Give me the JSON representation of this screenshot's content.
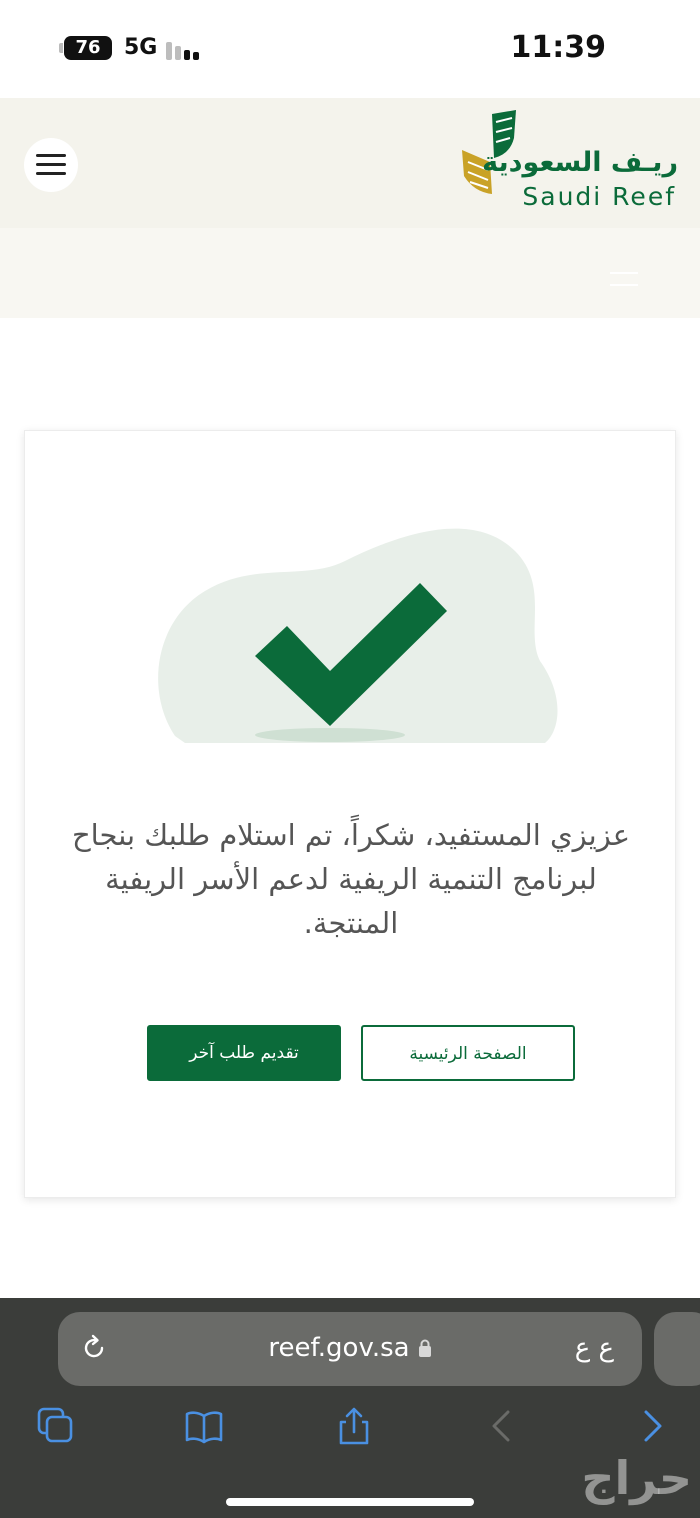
{
  "status_bar": {
    "battery": "76",
    "network": "5G",
    "time": "11:39"
  },
  "header": {
    "logo_arabic": "ريـف السعودية",
    "logo_english": "Saudi Reef"
  },
  "confirmation": {
    "message": "عزيزي المستفيد، شكراً، تم استلام طلبك بنجاح لبرنامج التنمية الريفية لدعم الأسر الريفية المنتجة.",
    "primary_button": "تقديم طلب آخر",
    "secondary_button": "الصفحة الرئيسية"
  },
  "browser": {
    "url": "reef.gov.sa",
    "aa_label": "ع ع"
  },
  "watermark": "حراج",
  "colors": {
    "brand_green": "#0b6b3a",
    "gold": "#c9a227",
    "header_bg": "#f4f3ec",
    "browser_bar": "#3b3d3a"
  },
  "icons": [
    "menu-icon",
    "reload-icon",
    "lock-icon",
    "tabs-icon",
    "bookmarks-icon",
    "share-icon",
    "back-icon",
    "forward-icon",
    "checkmark-icon"
  ]
}
